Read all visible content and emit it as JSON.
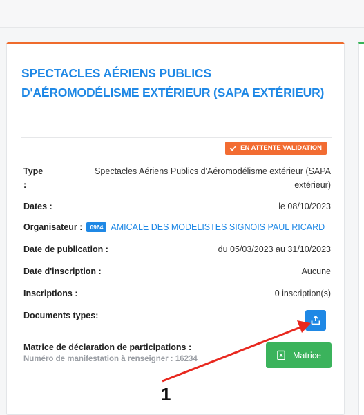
{
  "card": {
    "title": "SPECTACLES AÉRIENS PUBLICS D'AÉROMODÉLISME EXTÉRIEUR (SAPA EXTÉRIEUR)",
    "status_badge": "EN ATTENTE VALIDATION",
    "fields": {
      "type_label": "Type",
      "type_colon": ":",
      "type_value_line1": "Spectacles Aériens Publics d'Aéromodélisme extérieur (SAPA",
      "type_value_line2": "extérieur)",
      "dates_label": "Dates :",
      "dates_value": "le 08/10/2023",
      "organisateur_label": "Organisateur :",
      "organisateur_code": "0964",
      "organisateur_name": "AMICALE DES MODELISTES SIGNOIS PAUL RICARD",
      "publication_label": "Date de publication :",
      "publication_value": "du 05/03/2023 au 31/10/2023",
      "inscription_date_label": "Date d'inscription :",
      "inscription_date_value": "Aucune",
      "inscriptions_label": "Inscriptions :",
      "inscriptions_value": "0 inscription(s)",
      "documents_label": "Documents types:"
    },
    "matrice": {
      "label": "Matrice de déclaration de participations :",
      "sub_label": "Numéro de manifestation à renseigner : 16234",
      "button_label": "Matrice"
    }
  },
  "annotation": {
    "number": "1",
    "color": "#e8281f"
  },
  "colors": {
    "accent_blue": "#1f88e5",
    "badge_orange": "#f26c32",
    "card_top_border": "#ef6b2c",
    "matrice_green": "#3bb35c"
  },
  "icons": {
    "badge": "check-icon",
    "upload": "upload-icon",
    "matrice": "excel-file-icon"
  }
}
